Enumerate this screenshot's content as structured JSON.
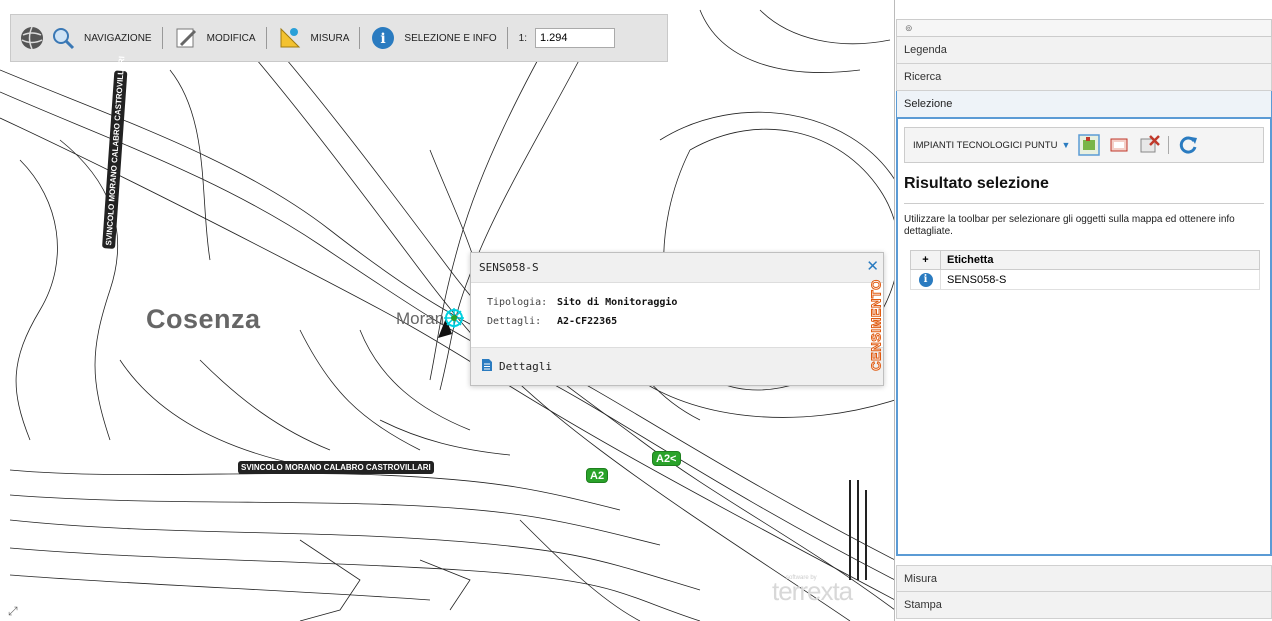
{
  "toolbar": {
    "navigazione": "NAVIGAZIONE",
    "modifica": "MODIFICA",
    "misura": "MISURA",
    "selezione_info": "SELEZIONE E INFO",
    "scale_prefix": "1:",
    "scale_value": "1.294"
  },
  "map": {
    "city_label": "Cosenza",
    "place_label": "Moran",
    "road_label_h": "SVINCOLO MORANO CALABRO CASTROVILLARI",
    "road_label_v": "SVINCOLO MORANO CALABRO CASTROVILLARI",
    "badge_a2_1": "A2",
    "badge_a2_2": "A2<",
    "watermark": "terrexta",
    "watermark_small": "software by",
    "side_stamp": "CENSIMENTO"
  },
  "popup": {
    "title": "SENS058-S",
    "rows": [
      {
        "key": "Tipologia:",
        "value": "Sito di Monitoraggio"
      },
      {
        "key": "Dettagli:",
        "value": "A2-CF22365"
      }
    ],
    "footer_link": "Dettagli"
  },
  "panel": {
    "top_toggle": "⊚",
    "sections": {
      "legenda": "Legenda",
      "ricerca": "Ricerca",
      "selezione": "Selezione",
      "misura": "Misura",
      "stampa": "Stampa"
    },
    "layer_select": "IMPIANTI TECNOLOGICI PUNTU",
    "result_title": "Risultato selezione",
    "result_desc": "Utilizzare la toolbar per selezionare gli oggetti sulla mappa ed ottenere info dettagliate.",
    "table": {
      "col_plus": "+",
      "col_label": "Etichetta",
      "rows": [
        {
          "label": "SENS058-S"
        }
      ]
    }
  }
}
